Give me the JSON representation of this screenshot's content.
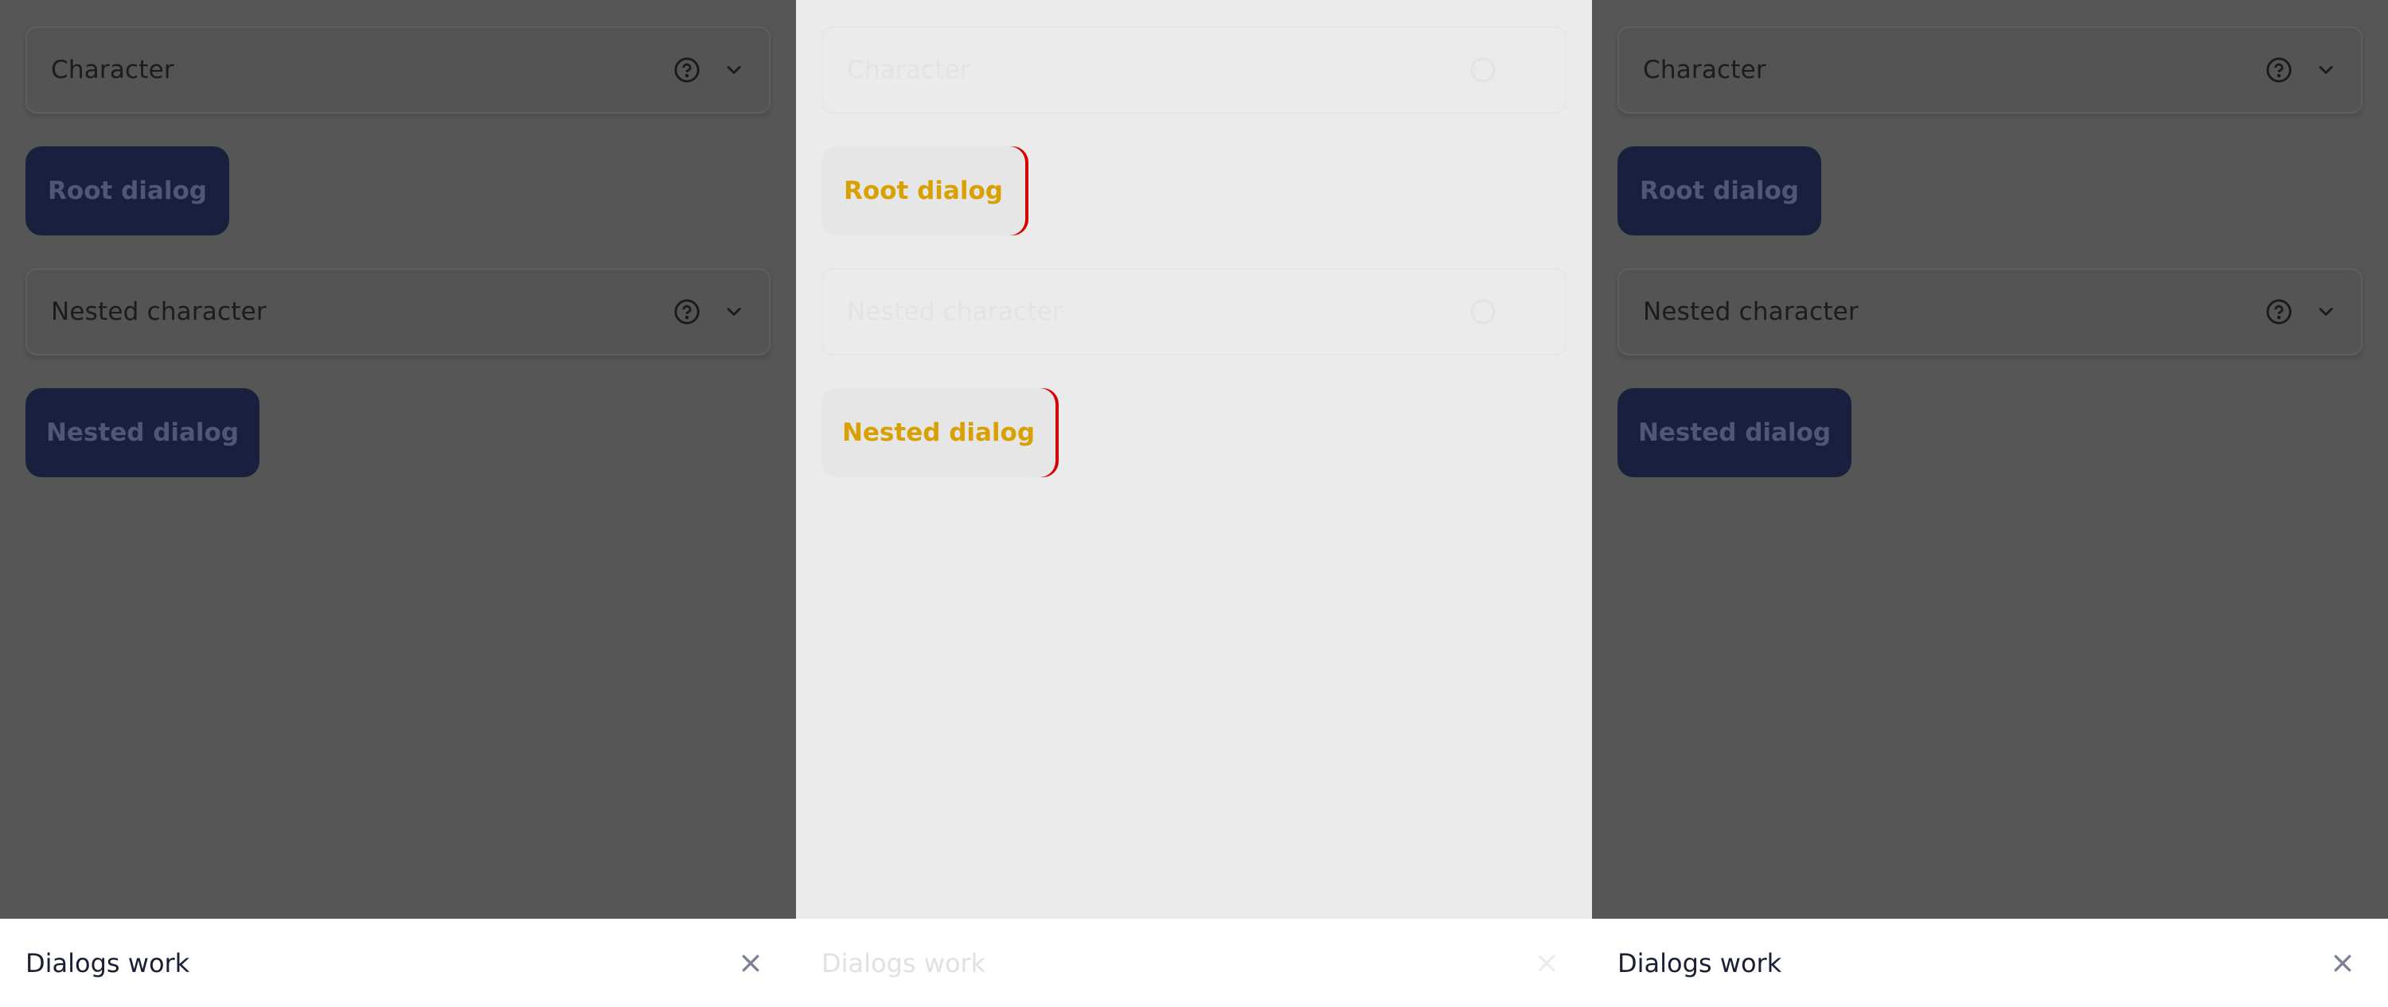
{
  "panels": [
    {
      "select_character": "Character",
      "root_dialog": "Root dialog",
      "select_nested": "Nested character",
      "nested_dialog": "Nested dialog",
      "footer_title": "Dialogs work"
    },
    {
      "select_character": "Character",
      "root_dialog": "Root dialog",
      "select_nested": "Nested character",
      "nested_dialog": "Nested dialog",
      "footer_title": "Dialogs work"
    },
    {
      "select_character": "Character",
      "root_dialog": "Root dialog",
      "select_nested": "Nested character",
      "nested_dialog": "Nested dialog",
      "footer_title": "Dialogs work"
    }
  ],
  "icons": {
    "help": "help-circle-icon",
    "chevron": "chevron-down-icon",
    "close": "close-icon"
  },
  "colors": {
    "overlay": "#565656",
    "button_bg": "#19203d",
    "button_text": "#505678",
    "diff_yellow": "#d8a000",
    "diff_red": "#d60000"
  }
}
